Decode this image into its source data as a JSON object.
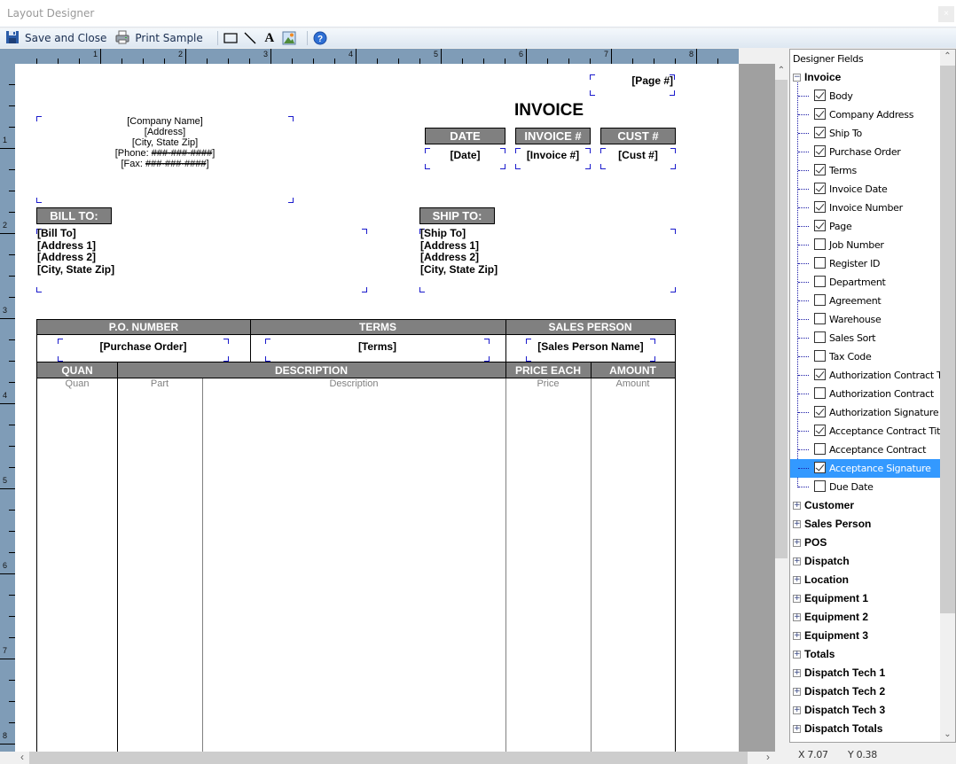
{
  "window": {
    "title": "Layout Designer",
    "close_glyph": "×"
  },
  "toolbar": {
    "save_close_label": "Save and Close",
    "print_sample_label": "Print Sample",
    "tools": [
      {
        "name": "rectangle-tool",
        "icon": "rectangle-icon"
      },
      {
        "name": "line-tool",
        "icon": "line-icon"
      },
      {
        "name": "text-tool",
        "icon": "text-icon",
        "glyph": "A"
      },
      {
        "name": "image-tool",
        "icon": "image-icon"
      }
    ],
    "help_icon": "help-icon"
  },
  "rulers": {
    "horizontal_labels": [
      "1",
      "2",
      "3",
      "4",
      "5",
      "6",
      "7",
      "8"
    ],
    "vertical_labels": [
      "1",
      "2",
      "3",
      "4",
      "5",
      "6",
      "7",
      "8"
    ]
  },
  "page": {
    "page_number_field": "[Page #]",
    "invoice_title": "INVOICE",
    "company": {
      "name": "[Company Name]",
      "address": "[Address]",
      "city_state_zip": "[City, State Zip]",
      "phone_prefix": "[Phone: ",
      "phone_mask": "###-###-####",
      "fax_prefix": "[Fax: ",
      "fax_mask": "###-###-####",
      "suffix": "]"
    },
    "header_boxes": [
      {
        "label": "DATE",
        "field": "[Date]"
      },
      {
        "label": "INVOICE #",
        "field": "[Invoice #]"
      },
      {
        "label": "CUST #",
        "field": "[Cust #]"
      }
    ],
    "bill_to": {
      "label": "BILL TO:",
      "lines": [
        "[Bill To]",
        "[Address 1]",
        "[Address 2]",
        "[City, State Zip]"
      ]
    },
    "ship_to": {
      "label": "SHIP TO:",
      "lines": [
        "[Ship To]",
        "[Address 1]",
        "[Address 2]",
        "[City, State Zip]"
      ]
    },
    "info_table": {
      "headers": [
        "P.O. NUMBER",
        "TERMS",
        "SALES PERSON"
      ],
      "fields": [
        "[Purchase Order]",
        "[Terms]",
        "[Sales Person Name]"
      ]
    },
    "items_table": {
      "headers": [
        "QUAN",
        "DESCRIPTION",
        "PRICE EACH",
        "AMOUNT"
      ],
      "sub_columns": [
        "Quan",
        "Part",
        "Description",
        "Price",
        "Amount"
      ]
    }
  },
  "designer_fields": {
    "title": "Designer Fields",
    "groups": [
      {
        "label": "Invoice",
        "expanded": true,
        "items": [
          {
            "label": "Body",
            "checked": true
          },
          {
            "label": "Company Address",
            "checked": true
          },
          {
            "label": "Ship To",
            "checked": true
          },
          {
            "label": "Purchase Order",
            "checked": true
          },
          {
            "label": "Terms",
            "checked": true
          },
          {
            "label": "Invoice Date",
            "checked": true
          },
          {
            "label": "Invoice Number",
            "checked": true
          },
          {
            "label": "Page",
            "checked": true
          },
          {
            "label": "Job Number",
            "checked": false
          },
          {
            "label": "Register ID",
            "checked": false
          },
          {
            "label": "Department",
            "checked": false
          },
          {
            "label": "Agreement",
            "checked": false
          },
          {
            "label": "Warehouse",
            "checked": false
          },
          {
            "label": "Sales Sort",
            "checked": false
          },
          {
            "label": "Tax Code",
            "checked": false
          },
          {
            "label": "Authorization Contract Title",
            "checked": true
          },
          {
            "label": "Authorization Contract",
            "checked": false
          },
          {
            "label": "Authorization Signature",
            "checked": true
          },
          {
            "label": "Acceptance Contract Title",
            "checked": true
          },
          {
            "label": "Acceptance Contract",
            "checked": false
          },
          {
            "label": "Acceptance Signature",
            "checked": true,
            "selected": true
          },
          {
            "label": "Due Date",
            "checked": false
          }
        ]
      },
      {
        "label": "Customer",
        "expanded": false
      },
      {
        "label": "Sales Person",
        "expanded": false
      },
      {
        "label": "POS",
        "expanded": false
      },
      {
        "label": "Dispatch",
        "expanded": false
      },
      {
        "label": "Location",
        "expanded": false
      },
      {
        "label": "Equipment 1",
        "expanded": false
      },
      {
        "label": "Equipment 2",
        "expanded": false
      },
      {
        "label": "Equipment 3",
        "expanded": false
      },
      {
        "label": "Totals",
        "expanded": false
      },
      {
        "label": "Dispatch Tech 1",
        "expanded": false
      },
      {
        "label": "Dispatch Tech 2",
        "expanded": false
      },
      {
        "label": "Dispatch Tech 3",
        "expanded": false
      },
      {
        "label": "Dispatch Totals",
        "expanded": false
      }
    ]
  },
  "status": {
    "x": "X 7.07",
    "y": "Y 0.38"
  },
  "colors": {
    "ruler": "#7f9cb7",
    "header_fill": "#808080",
    "selection": "#3399ff",
    "field_corner": "#1a1acc"
  }
}
